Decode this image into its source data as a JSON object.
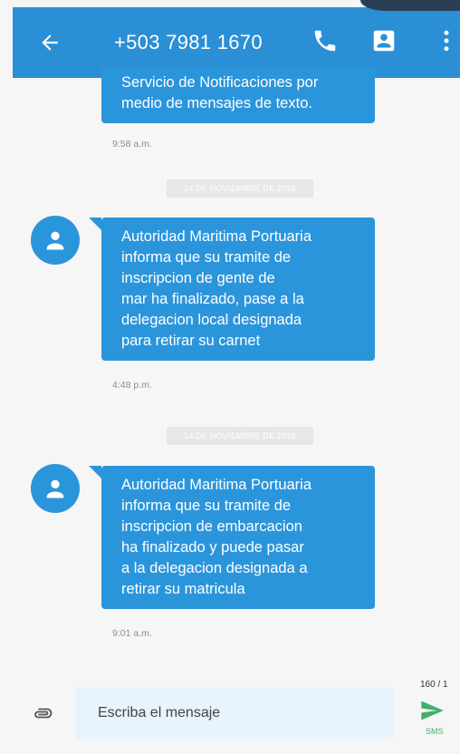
{
  "header": {
    "title": "+503 7981 1670"
  },
  "messages": [
    {
      "lines": [
        "Servicio de Notificaciones por",
        "medio de mensajes de texto."
      ],
      "time": "9:58 a.m."
    },
    {
      "date": "14 DE NOVIEMBRE DE 2018",
      "lines": [
        "Autoridad Maritima Portuaria",
        "informa que su tramite de",
        "inscripcion de gente de",
        "mar ha finalizado, pase a la",
        "delegacion local designada",
        "para retirar su carnet"
      ],
      "time": "4:48 p.m."
    },
    {
      "date": "14 DE NOVIEMBRE DE 2018",
      "lines": [
        "Autoridad Maritima Portuaria",
        "informa que su tramite de",
        "inscripcion de embarcacion",
        "ha finalizado y puede pasar",
        "a la delegacion designada a",
        "retirar su matricula"
      ],
      "time": "9:01 a.m."
    }
  ],
  "composer": {
    "placeholder": "Escriba el mensaje",
    "counter": "160 / 1",
    "send_type": "SMS"
  },
  "colors": {
    "appbar": "#2b8fd6",
    "bubble": "#2b95dc",
    "send": "#41b06e"
  },
  "icons": [
    "back-arrow-icon",
    "phone-icon",
    "contact-card-icon",
    "more-vert-icon",
    "person-icon",
    "paperclip-icon",
    "send-icon"
  ]
}
